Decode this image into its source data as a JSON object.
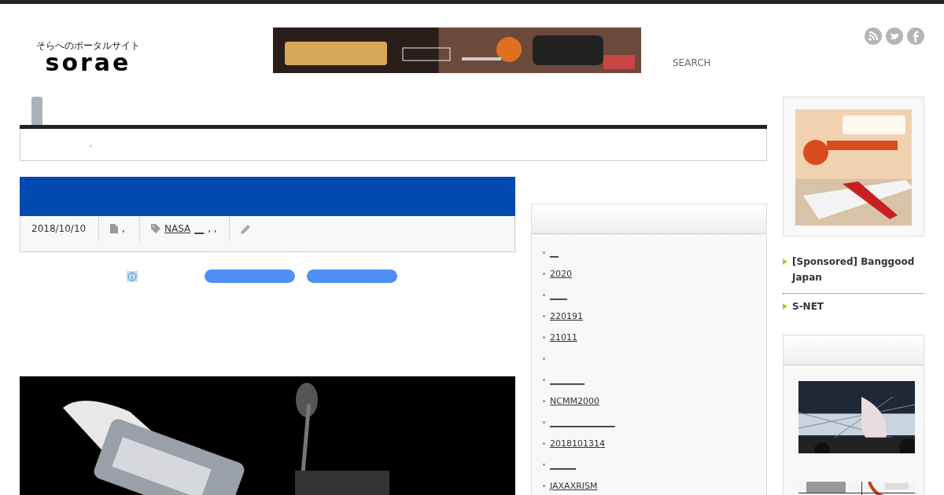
{
  "header": {
    "tagline": "そらへのポータルサイト",
    "logo": "sorae",
    "search": "SEARCH"
  },
  "breadcrumb": ",",
  "post": {
    "date": "2018/10/10",
    "category": ",",
    "tags": [
      "NASA",
      "__",
      ", ,"
    ]
  },
  "widget": {
    "items": [
      {
        "kind": "link",
        "label": "__"
      },
      {
        "kind": "link",
        "label": "2020"
      },
      {
        "kind": "link",
        "label": "____"
      },
      {
        "kind": "link",
        "label": "220191"
      },
      {
        "kind": "link",
        "label": "21011"
      },
      {
        "kind": "empty"
      },
      {
        "kind": "link",
        "label": "________"
      },
      {
        "kind": "link",
        "label": "NCMM2000"
      },
      {
        "kind": "link",
        "label": "_______________"
      },
      {
        "kind": "link",
        "label": "2018101314"
      },
      {
        "kind": "link",
        "label": "______"
      },
      {
        "kind": "link",
        "label": "JAXAXRISM"
      }
    ]
  },
  "sidebar": {
    "links": [
      "[Sponsored] Banggood Japan",
      "S-NET"
    ]
  }
}
